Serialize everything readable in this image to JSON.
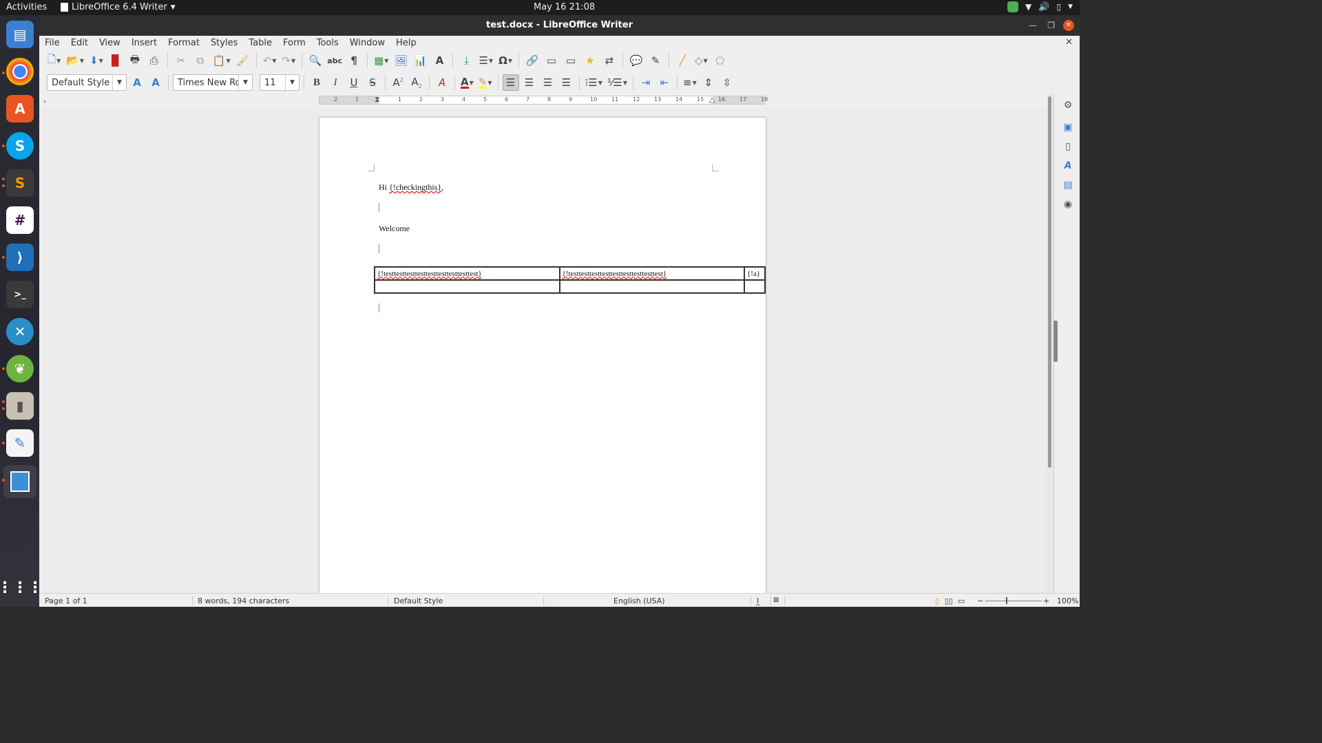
{
  "topbar": {
    "activities": "Activities",
    "app_name": "LibreOffice 6.4 Writer",
    "clock": "May 16  21:08"
  },
  "dock": {
    "apps": [
      {
        "name": "files",
        "label": "Files"
      },
      {
        "name": "chrome",
        "label": "Google Chrome"
      },
      {
        "name": "software",
        "label": "Ubuntu Software"
      },
      {
        "name": "skype",
        "label": "Skype"
      },
      {
        "name": "sublime",
        "label": "Sublime Text"
      },
      {
        "name": "slack",
        "label": "Slack"
      },
      {
        "name": "vscode",
        "label": "Visual Studio Code"
      },
      {
        "name": "terminal",
        "label": "Terminal"
      },
      {
        "name": "crossover",
        "label": "CrossOver"
      },
      {
        "name": "spring",
        "label": "Spring Tool Suite"
      },
      {
        "name": "archive",
        "label": "Archive Manager"
      },
      {
        "name": "text-editor",
        "label": "Text Editor"
      },
      {
        "name": "image-viewer",
        "label": "Image Viewer"
      }
    ],
    "show_apps": "Show Applications"
  },
  "window": {
    "title": "test.docx - LibreOffice Writer"
  },
  "menubar": {
    "items": [
      "File",
      "Edit",
      "View",
      "Insert",
      "Format",
      "Styles",
      "Table",
      "Form",
      "Tools",
      "Window",
      "Help"
    ]
  },
  "formatting": {
    "paragraph_style": "Default Style",
    "font_name": "Times New Ron",
    "font_size": "11",
    "font_color": "#c9211e",
    "highlight_color": "#ffff00"
  },
  "ruler": {
    "labels": [
      "2",
      "1",
      "1",
      "2",
      "3",
      "4",
      "5",
      "6",
      "7",
      "8",
      "9",
      "10",
      "11",
      "12",
      "13",
      "14",
      "15",
      "16",
      "17",
      "18"
    ]
  },
  "document": {
    "greeting_prefix": "Hi ",
    "greeting_field": "{!checkingthis}",
    "greeting_suffix": ",",
    "welcome": "Welcome",
    "table": {
      "rows": [
        [
          "{!testtesttesttesttesttesttesttesttest}",
          "{!testtesttesttesttesttesttesttesttest}",
          "{!a}"
        ],
        [
          "",
          "",
          ""
        ]
      ]
    }
  },
  "statusbar": {
    "page": "Page 1 of 1",
    "words": "8 words, 194 characters",
    "style": "Default Style",
    "language": "English (USA)",
    "zoom": "100%"
  }
}
